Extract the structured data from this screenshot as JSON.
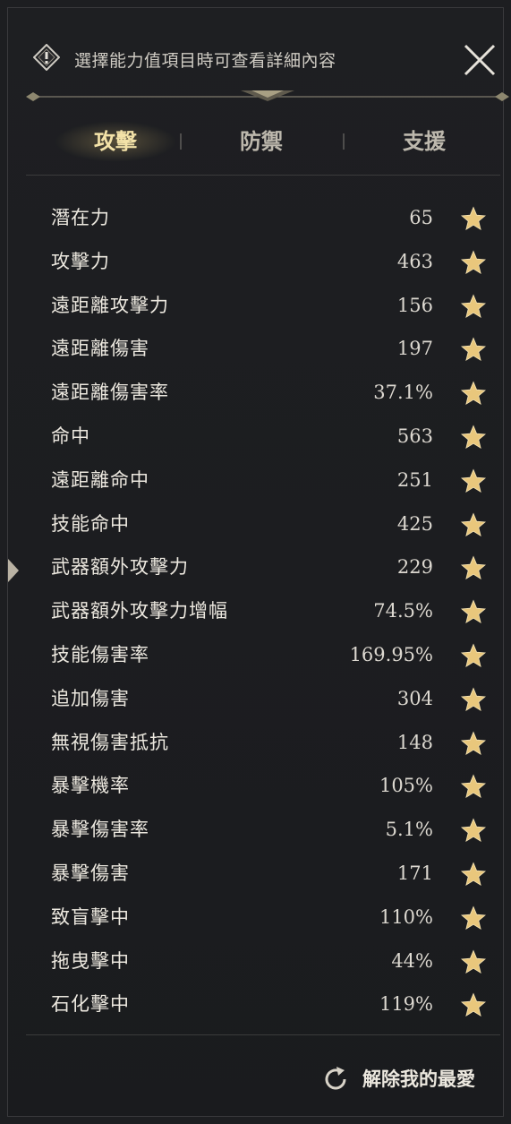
{
  "header": {
    "info_text": "選擇能力值項目時可查看詳細內容",
    "info_icon": "exclamation-diamond-icon",
    "close_icon": "close-icon"
  },
  "tabs": [
    {
      "label": "攻擊",
      "active": true
    },
    {
      "label": "防禦",
      "active": false
    },
    {
      "label": "支援",
      "active": false
    }
  ],
  "stats": [
    {
      "label": "潛在力",
      "value": "65"
    },
    {
      "label": "攻擊力",
      "value": "463"
    },
    {
      "label": "遠距離攻擊力",
      "value": "156"
    },
    {
      "label": "遠距離傷害",
      "value": "197"
    },
    {
      "label": "遠距離傷害率",
      "value": "37.1%"
    },
    {
      "label": "命中",
      "value": "563"
    },
    {
      "label": "遠距離命中",
      "value": "251"
    },
    {
      "label": "技能命中",
      "value": "425"
    },
    {
      "label": "武器額外攻擊力",
      "value": "229"
    },
    {
      "label": "武器額外攻擊力增幅",
      "value": "74.5%"
    },
    {
      "label": "技能傷害率",
      "value": "169.95%"
    },
    {
      "label": "追加傷害",
      "value": "304"
    },
    {
      "label": "無視傷害抵抗",
      "value": "148"
    },
    {
      "label": "暴擊機率",
      "value": "105%"
    },
    {
      "label": "暴擊傷害率",
      "value": "5.1%"
    },
    {
      "label": "暴擊傷害",
      "value": "171"
    },
    {
      "label": "致盲擊中",
      "value": "110%"
    },
    {
      "label": "拖曳擊中",
      "value": "44%"
    },
    {
      "label": "石化擊中",
      "value": "119%"
    }
  ],
  "footer": {
    "label": "解除我的最愛",
    "icon": "refresh-icon"
  },
  "colors": {
    "star": "#e9c77c",
    "active_tab": "#f3e2a8",
    "panel_bg": "#1d1e21"
  }
}
